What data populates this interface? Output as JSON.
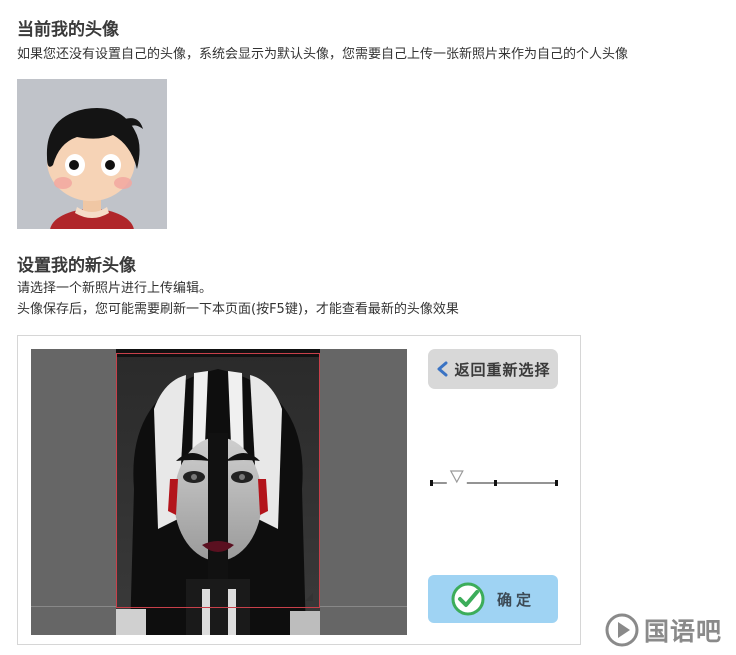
{
  "current_section": {
    "title": "当前我的头像",
    "description": "如果您还没有设置自己的头像，系统会显示为默认头像，您需要自己上传一张新照片来作为自己的个人头像"
  },
  "new_section": {
    "title": "设置我的新头像",
    "line1": "请选择一个新照片进行上传编辑。",
    "line2": "头像保存后，您可能需要刷新一下本页面(按F5键)，才能查看最新的头像效果"
  },
  "editor": {
    "back_button_label": "返回重新选择",
    "confirm_button_label": "确定",
    "zoom_level": 0.2,
    "colors": {
      "crop_border": "#c8404a",
      "confirm_bg": "#9fd3f3",
      "back_bg": "#d8d8d8",
      "arrow": "#3a73c4",
      "check": "#3cad5a"
    }
  },
  "watermark": {
    "text": "国语吧",
    "icon": "play-icon"
  }
}
